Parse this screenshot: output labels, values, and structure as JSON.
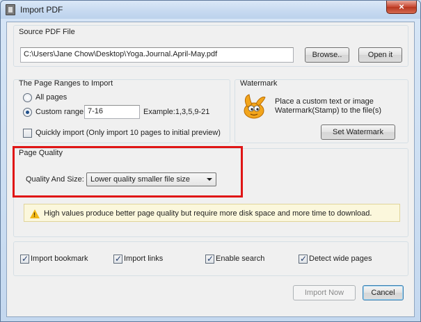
{
  "window": {
    "title": "Import PDF",
    "close_glyph": "×"
  },
  "source": {
    "group_title": "Source PDF File",
    "path_value": "C:\\Users\\Jane Chow\\Desktop\\Yoga.Journal.April-May.pdf",
    "browse_label": "Browse..",
    "open_label": "Open it"
  },
  "page_ranges": {
    "group_title": "The Page Ranges to Import",
    "all_pages_label": "All pages",
    "custom_range_label": "Custom range:",
    "custom_range_value": "7-16",
    "example_text": "Example:1,3,5,9-21",
    "selected": "custom",
    "quick_import_label": "Quickly import (Only import 10 pages to  initial  preview)",
    "quick_import_checked": false
  },
  "watermark": {
    "group_title": "Watermark",
    "description_line1": "Place a custom text or image",
    "description_line2": "Watermark(Stamp) to the file(s)",
    "set_label": "Set Watermark",
    "icon": "gimp-mascot-icon"
  },
  "quality": {
    "group_title": "Page Quality",
    "field_label": "Quality And Size:",
    "selected_option": "Lower quality smaller file size",
    "warning_text": "High values produce better page quality but require more disk space and more time to download."
  },
  "options": [
    {
      "label": "Import bookmark",
      "checked": true
    },
    {
      "label": "Import links",
      "checked": true
    },
    {
      "label": "Enable search",
      "checked": true
    },
    {
      "label": "Detect wide pages",
      "checked": true
    }
  ],
  "footer": {
    "import_label": "Import Now",
    "import_enabled": false,
    "cancel_label": "Cancel"
  },
  "colors": {
    "highlight": "#e01515",
    "warning_bg": "#fbf7dc",
    "warning_icon": "#f2b817"
  }
}
